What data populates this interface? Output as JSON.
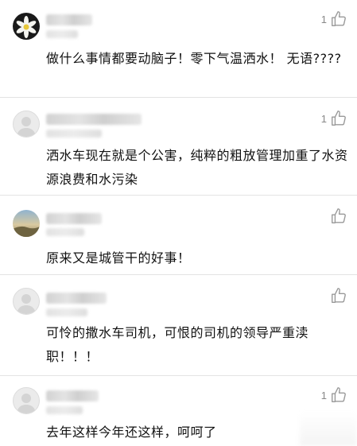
{
  "comments": [
    {
      "avatar": "flower-avatar",
      "likes": "1",
      "text": "做什么事情都要动脑子！零下气温洒水！ 无语????"
    },
    {
      "avatar": "default-avatar",
      "likes": "1",
      "text": "洒水车现在就是个公害，纯粹的粗放管理加重了水资源浪费和水污染"
    },
    {
      "avatar": "landscape-avatar",
      "likes": "",
      "text": "原来又是城管干的好事！"
    },
    {
      "avatar": "default-avatar",
      "likes": "",
      "text": "可怜的撒水车司机，可恨的司机的领导严重渎职！！！"
    },
    {
      "avatar": "default-avatar",
      "likes": "1",
      "text": "去年这样今年还这样，呵呵了"
    }
  ],
  "icons": {
    "like": "thumbs-up-icon"
  },
  "colors": {
    "text": "#111111",
    "meta": "#999999",
    "divider": "#e3e3e3"
  }
}
